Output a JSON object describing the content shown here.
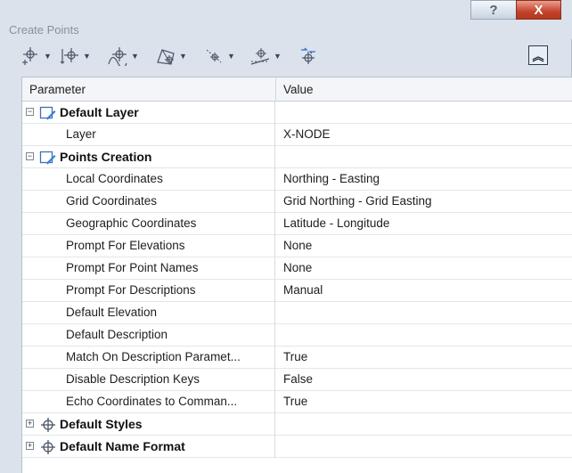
{
  "window": {
    "title": "Create Points"
  },
  "caption": {
    "help_icon": "?",
    "close_icon": "X"
  },
  "toolbar": {
    "buttons": [
      {
        "name": "miscellaneous-points-icon"
      },
      {
        "name": "intersection-points-icon"
      },
      {
        "name": "alignment-points-icon"
      },
      {
        "name": "surface-points-icon"
      },
      {
        "name": "interpolate-points-icon"
      },
      {
        "name": "slope-points-icon"
      },
      {
        "name": "convert-points-icon"
      }
    ],
    "collapse_glyph": "︽"
  },
  "grid": {
    "headers": {
      "parameter": "Parameter",
      "value": "Value"
    },
    "groups": [
      {
        "label": "Default Layer",
        "expander": "−",
        "rows": [
          {
            "param": "Layer",
            "value": "X-NODE"
          }
        ]
      },
      {
        "label": "Points Creation",
        "expander": "−",
        "rows": [
          {
            "param": "Local Coordinates",
            "value": "Northing - Easting"
          },
          {
            "param": "Grid Coordinates",
            "value": "Grid Northing - Grid Easting"
          },
          {
            "param": "Geographic Coordinates",
            "value": "Latitude - Longitude"
          },
          {
            "param": "Prompt For Elevations",
            "value": "None"
          },
          {
            "param": "Prompt For Point Names",
            "value": "None"
          },
          {
            "param": "Prompt For Descriptions",
            "value": "Manual"
          },
          {
            "param": "Default Elevation",
            "value": ""
          },
          {
            "param": "Default Description",
            "value": ""
          },
          {
            "param": "Match On Description Paramet...",
            "value": "True"
          },
          {
            "param": "Disable Description Keys",
            "value": "False"
          },
          {
            "param": "Echo Coordinates to Comman...",
            "value": "True"
          }
        ]
      },
      {
        "label": "Default Styles",
        "expander": "+",
        "rows": []
      },
      {
        "label": "Default Name Format",
        "expander": "+",
        "rows": []
      }
    ]
  }
}
